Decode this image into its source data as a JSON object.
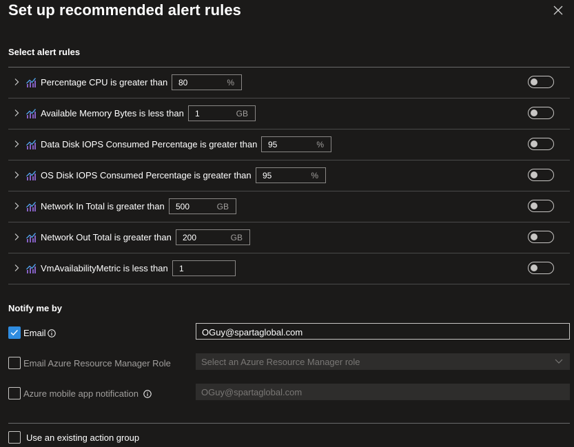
{
  "title": "Set up recommended alert rules",
  "sections": {
    "alert_rules_label": "Select alert rules",
    "notify_label": "Notify me by"
  },
  "rules": [
    {
      "label": "Percentage CPU is greater than",
      "value": "80",
      "unit": "%",
      "enabled": false
    },
    {
      "label": "Available Memory Bytes is less than",
      "value": "1",
      "unit": "GB",
      "enabled": false
    },
    {
      "label": "Data Disk IOPS Consumed Percentage is greater than",
      "value": "95",
      "unit": "%",
      "enabled": false
    },
    {
      "label": "OS Disk IOPS Consumed Percentage is greater than",
      "value": "95",
      "unit": "%",
      "enabled": false
    },
    {
      "label": "Network In Total is greater than",
      "value": "500",
      "unit": "GB",
      "enabled": false
    },
    {
      "label": "Network Out Total is greater than",
      "value": "200",
      "unit": "GB",
      "enabled": false
    },
    {
      "label": "VmAvailabilityMetric is less than",
      "value": "1",
      "unit": "",
      "enabled": false
    }
  ],
  "notify": {
    "email": {
      "label": "Email",
      "checked": true,
      "value": "OGuy@spartaglobal.com"
    },
    "arm_role": {
      "label": "Email Azure Resource Manager Role",
      "checked": false,
      "placeholder": "Select an Azure Resource Manager role"
    },
    "mobile": {
      "label": "Azure mobile app notification",
      "checked": false,
      "placeholder": "OGuy@spartaglobal.com"
    }
  },
  "action_group": {
    "label": "Use an existing action group",
    "checked": false
  },
  "colors": {
    "background": "#1b1a19",
    "accent": "#2f8ce0",
    "divider": "#6b6b6b",
    "muted_text": "#797775"
  }
}
